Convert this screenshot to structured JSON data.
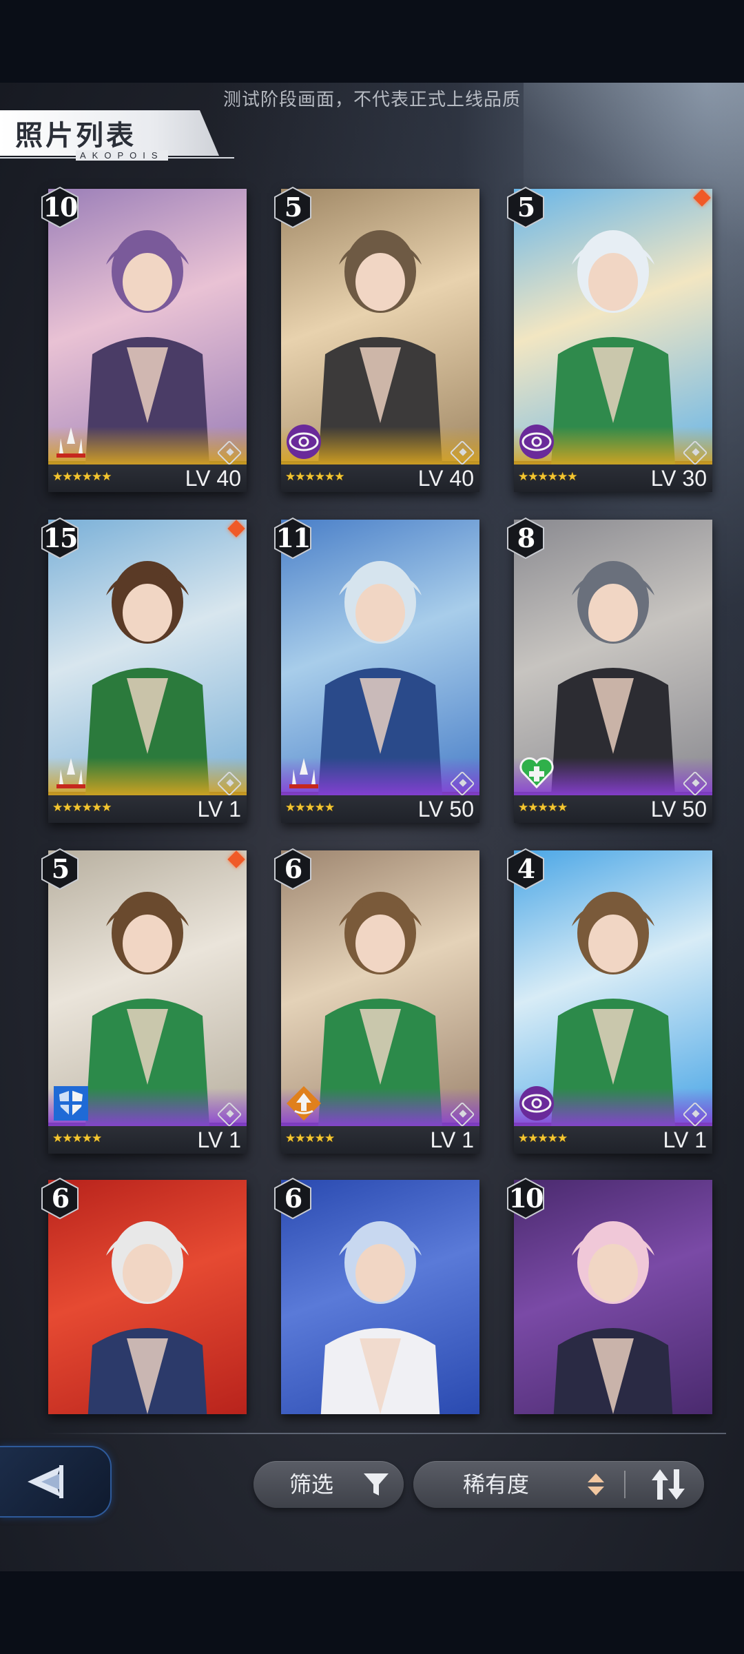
{
  "watermark": "测试阶段画面，不代表正式上线品质",
  "header": {
    "title": "照片列表",
    "subtitle": "AKOPOIS"
  },
  "cards": [
    {
      "count": "10",
      "level": "LV 40",
      "stars": "★★★★★★",
      "role": "attack",
      "rarity": "gold",
      "new": false
    },
    {
      "count": "5",
      "level": "LV 40",
      "stars": "★★★★★★",
      "role": "control",
      "rarity": "gold",
      "new": false
    },
    {
      "count": "5",
      "level": "LV 30",
      "stars": "★★★★★★",
      "role": "control",
      "rarity": "gold",
      "new": true
    },
    {
      "count": "15",
      "level": "LV 1",
      "stars": "★★★★★★",
      "role": "attack",
      "rarity": "gold",
      "new": true
    },
    {
      "count": "11",
      "level": "LV 50",
      "stars": "★★★★★",
      "role": "attack",
      "rarity": "purple",
      "new": false
    },
    {
      "count": "8",
      "level": "LV 50",
      "stars": "★★★★★",
      "role": "heal",
      "rarity": "purple",
      "new": false
    },
    {
      "count": "5",
      "level": "LV 1",
      "stars": "★★★★★",
      "role": "defense",
      "rarity": "purple",
      "new": true
    },
    {
      "count": "6",
      "level": "LV 1",
      "stars": "★★★★★",
      "role": "support",
      "rarity": "purple",
      "new": false
    },
    {
      "count": "4",
      "level": "LV 1",
      "stars": "★★★★★",
      "role": "control",
      "rarity": "purple",
      "new": false
    },
    {
      "count": "6",
      "level": "",
      "stars": "",
      "role": "",
      "rarity": "",
      "new": false
    },
    {
      "count": "6",
      "level": "",
      "stars": "",
      "role": "",
      "rarity": "",
      "new": false
    },
    {
      "count": "10",
      "level": "",
      "stars": "",
      "role": "",
      "rarity": "",
      "new": false
    }
  ],
  "toolbar": {
    "filter_label": "筛选",
    "sort_label": "稀有度"
  },
  "colors": {
    "gold": "#d9a520",
    "purple": "#8a3fd6",
    "new_dot": "#f05a28",
    "accent_blue": "#2e5a9a"
  }
}
